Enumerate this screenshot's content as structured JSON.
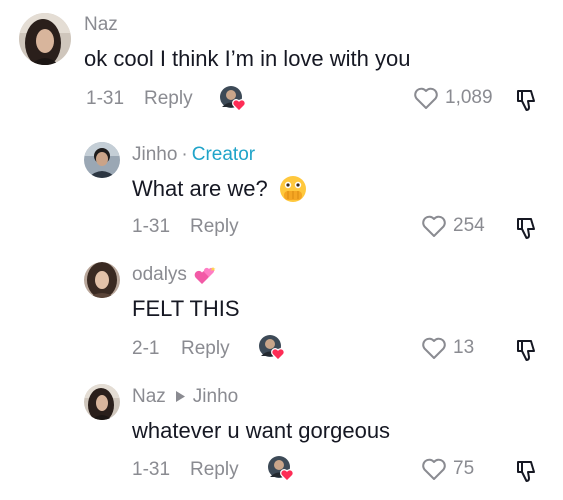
{
  "comments": [
    {
      "username": "Naz",
      "text": "ok cool I think I’m in love with you",
      "date": "1-31",
      "reply_label": "Reply",
      "likes": "1,089",
      "creator_liked": true,
      "avatar_icon": "avatar-photo-woman-dark-hair"
    },
    {
      "username": "Jinho",
      "separator": "·",
      "badge": "Creator",
      "text": "What are we?",
      "text_emoji": "face-with-open-eyes-and-hand-over-mouth-emoji",
      "date": "1-31",
      "reply_label": "Reply",
      "likes": "254",
      "creator_liked": false,
      "avatar_icon": "avatar-photo-man"
    },
    {
      "username": "odalys",
      "username_emoji": "two-hearts-emoji",
      "text": "FELT THIS",
      "date": "2-1",
      "reply_label": "Reply",
      "likes": "13",
      "creator_liked": true,
      "avatar_icon": "avatar-photo-woman"
    },
    {
      "username": "Naz",
      "reply_to": "Jinho",
      "text": "whatever u want gorgeous",
      "date": "1-31",
      "reply_label": "Reply",
      "likes": "75",
      "creator_liked": true,
      "avatar_icon": "avatar-photo-woman-dark-hair"
    }
  ],
  "colors": {
    "text": "#161823",
    "secondary": "#8a8b91",
    "creator_badge": "#20a4c9",
    "heart_badge": "#fe2c55"
  }
}
